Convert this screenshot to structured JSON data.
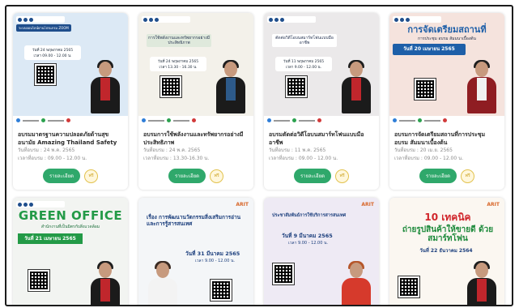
{
  "courses": [
    {
      "title": "อบรมมาตรฐานความปลอดภัยด้านสุขอนามัย Amazing Thailand Safety & Health Administration : SHA",
      "date_label": "วันที่อบรม",
      "date": "24 พ.ค. 2565",
      "time_label": "เวลาที่อบรม",
      "time": "09.00 - 12.00 น.",
      "detail_label": "รายละเอียด",
      "free_label": "ฟรี",
      "poster": {
        "heading": "ระบบออนไลน์ผ่านโปรแกรม ZOOM",
        "date_text": "วันที่ 24 พฤษภาคม 2565",
        "time_text": "เวลา 09.00 - 12.00 น."
      }
    },
    {
      "title": "อบรมการใช้พลังงานและทรัพยากรอย่างมีประสิทธิภาพ",
      "date_label": "วันที่อบรม",
      "date": "24 พ.ค. 2565",
      "time_label": "เวลาที่อบรม",
      "time": "13.30-16.30 น.",
      "detail_label": "รายละเอียด",
      "free_label": "ฟรี",
      "poster": {
        "heading": "การใช้พลังงานและทรัพยากรอย่างมีประสิทธิภาพ",
        "date_text": "วันที่ 24 พฤษภาคม 2565",
        "time_text": "เวลา 13.30 - 16.30 น."
      }
    },
    {
      "title": "อบรมตัดต่อวิดีโอบนสมาร์ทโฟนแบบมืออาชีพ",
      "date_label": "วันที่อบรม",
      "date": "11 พ.ค. 2565",
      "time_label": "เวลาที่อบรม",
      "time": "09.00 - 12.00 น.",
      "detail_label": "รายละเอียด",
      "free_label": "ฟรี",
      "poster": {
        "heading": "ตัดต่อวิดีโอบนสมาร์ทโฟนแบบมืออาชีพ",
        "date_text": "วันที่ 11 พฤษภาคม 2565",
        "time_text": "เวลา 9.00 - 12.00 น."
      }
    },
    {
      "title": "อบรมการจัดเตรียมสถานที่การประชุม อบรม สัมมนาเบื้องต้น",
      "date_label": "วันที่อบรม",
      "date": "20 เม.ย. 2565",
      "time_label": "เวลาที่อบรม",
      "time": "09.00 - 12.00 น.",
      "detail_label": "รายละเอียด",
      "free_label": "ฟรี",
      "poster": {
        "heading": "การจัดเตรียมสถานที่",
        "subheading": "การประชุม อบรม สัมมนาเบื้องต้น",
        "date_text": "วันที่ 20 เมษายน 2565",
        "time_text": "เวลา 9.00 - 12.00 น."
      }
    },
    {
      "poster": {
        "heading": "GREEN OFFICE",
        "subheading": "สำนักงานที่เป็นมิตรกับสิ่งแวดล้อม",
        "date_text": "วันที่ 21 เมษายน 2565"
      }
    },
    {
      "poster": {
        "heading": "เรื่อง การพัฒนานวัตกรรมสิ่งเสริมการอ่านและการรู้สารสนเทศ",
        "date_text": "วันที่ 31 มีนาคม 2565",
        "time_text": "เวลา 9.00 - 12.00 น.",
        "brand": "ARIT"
      }
    },
    {
      "poster": {
        "heading": "ประชาสัมพันธ์การใช้บริการสารสนเทศ",
        "date_text": "วันที่ 9 มีนาคม 2565",
        "time_text": "เวลา 9.00 - 12.00 น.",
        "brand": "ARIT"
      }
    },
    {
      "poster": {
        "heading": "10 เทคนิค",
        "subheading": "ถ่ายรูปสินค้าให้ขายดี ด้วยสมาร์ทโฟน",
        "date_text": "วันที่ 22 ธันวาคม 2564",
        "brand": "ARIT"
      }
    }
  ],
  "colors": {
    "accent_green": "#2fa86b",
    "free_gold": "#c69a11",
    "poster_blue": "#1f4e8c",
    "card_title": "#2b2b2b",
    "meta_gray": "#8b8b8b"
  },
  "icons": [
    "qr-code-icon",
    "person-photo",
    "facebook-icon",
    "line-icon",
    "youtube-icon"
  ]
}
